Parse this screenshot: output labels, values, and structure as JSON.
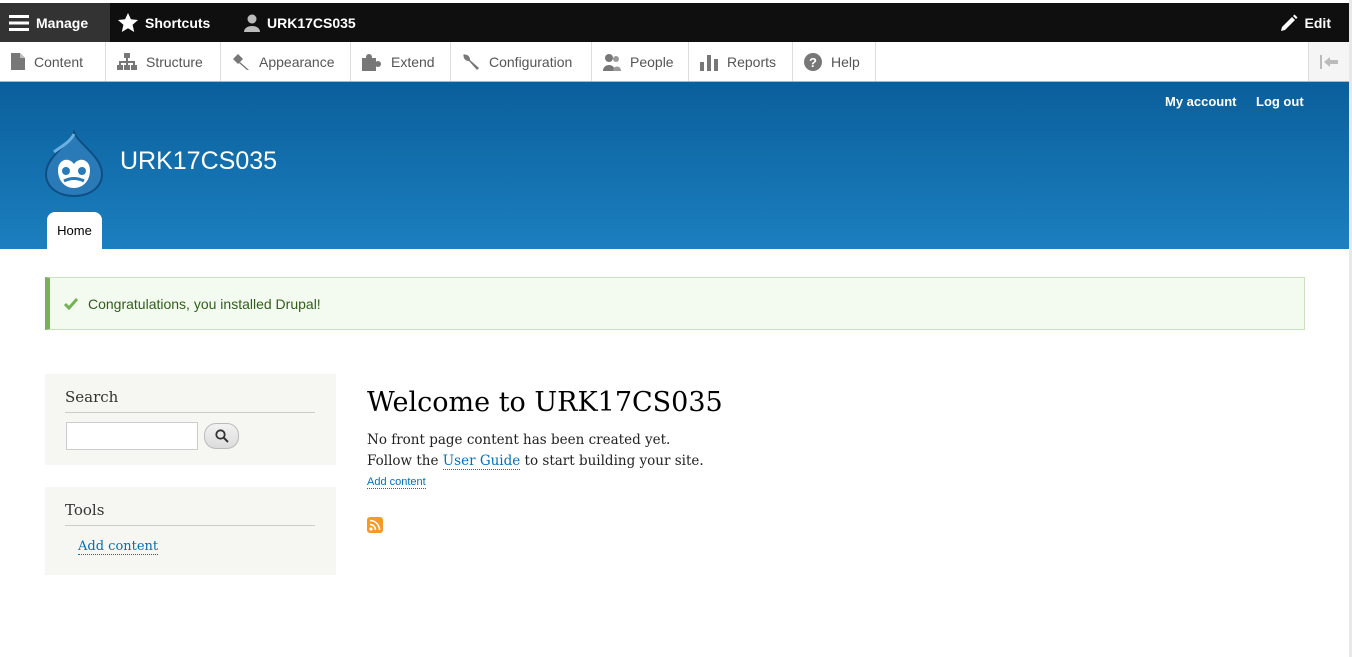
{
  "toolbar": {
    "manage": "Manage",
    "shortcuts": "Shortcuts",
    "user": "URK17CS035",
    "edit": "Edit"
  },
  "admin_menu": {
    "items": [
      {
        "label": "Content",
        "icon": "page-icon"
      },
      {
        "label": "Structure",
        "icon": "sitemap-icon"
      },
      {
        "label": "Appearance",
        "icon": "paintbrush-icon"
      },
      {
        "label": "Extend",
        "icon": "puzzle-icon"
      },
      {
        "label": "Configuration",
        "icon": "wrench-icon"
      },
      {
        "label": "People",
        "icon": "people-icon"
      },
      {
        "label": "Reports",
        "icon": "bar-chart-icon"
      },
      {
        "label": "Help",
        "icon": "help-icon"
      }
    ]
  },
  "header": {
    "my_account": "My account",
    "log_out": "Log out",
    "site_name": "URK17CS035",
    "home_tab": "Home"
  },
  "status_message": "Congratulations, you installed Drupal!",
  "sidebar": {
    "search_title": "Search",
    "search_value": "",
    "tools_title": "Tools",
    "tools_link": "Add content"
  },
  "main": {
    "title": "Welcome to URK17CS035",
    "line1": "No front page content has been created yet.",
    "line2_before": "Follow the ",
    "line2_link": "User Guide",
    "line2_after": " to start building your site.",
    "add_content": "Add content"
  },
  "colors": {
    "toolbar_bg": "#0f0f0f",
    "header_top": "#0a5f9b",
    "header_bottom": "#1c7fbf",
    "link": "#0071b8",
    "status_border": "#77b259",
    "feed": "#f59b25"
  }
}
